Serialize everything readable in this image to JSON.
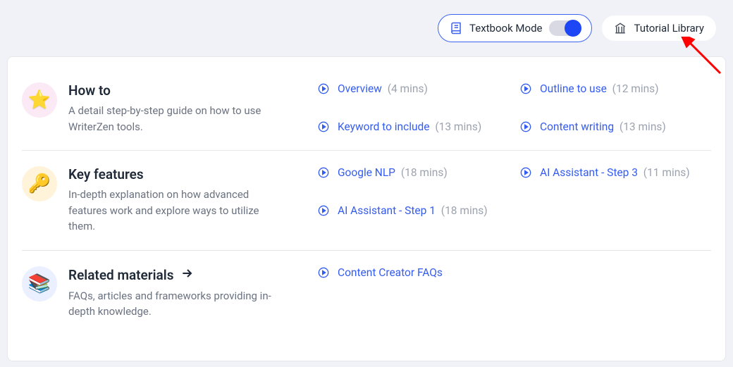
{
  "topbar": {
    "textbook_label": "Textbook Mode",
    "tutorial_label": "Tutorial Library"
  },
  "sections": {
    "howto": {
      "title": "How to",
      "desc": "A detail step-by-step guide on how to use WriterZen tools.",
      "links": [
        {
          "label": "Overview",
          "dur": "(4 mins)"
        },
        {
          "label": "Outline to use",
          "dur": "(12 mins)"
        },
        {
          "label": "Keyword to include",
          "dur": "(13 mins)"
        },
        {
          "label": "Content writing",
          "dur": "(13 mins)"
        }
      ]
    },
    "features": {
      "title": "Key features",
      "desc": "In-depth explanation on how advanced features work and explore ways to utilize them.",
      "links": [
        {
          "label": "Google NLP",
          "dur": "(18 mins)"
        },
        {
          "label": "AI Assistant - Step 3",
          "dur": "(11 mins)"
        },
        {
          "label": "AI Assistant - Step 1",
          "dur": "(18 mins)"
        }
      ]
    },
    "related": {
      "title": "Related materials",
      "desc": "FAQs, articles and frameworks providing in-depth knowledge.",
      "links": [
        {
          "label": "Content Creator FAQs",
          "dur": ""
        }
      ]
    }
  }
}
